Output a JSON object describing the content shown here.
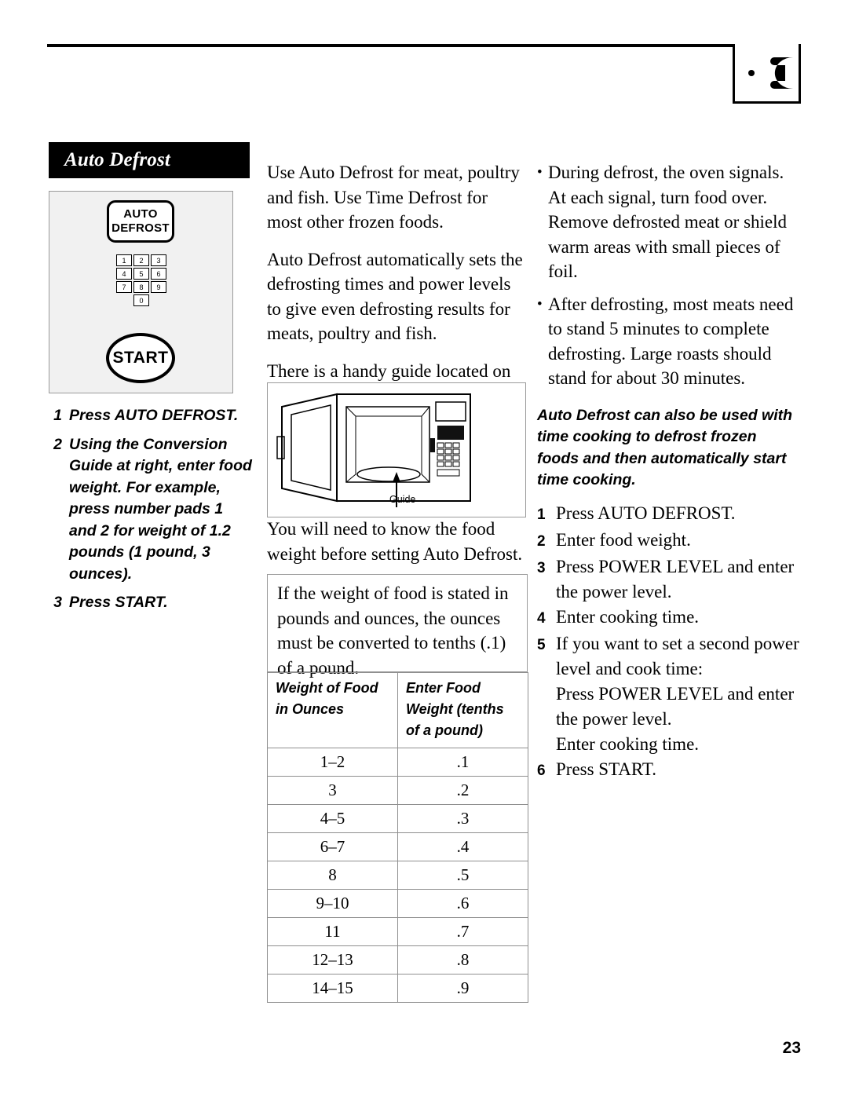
{
  "page": {
    "number": "23"
  },
  "section": {
    "title": "Auto Defrost"
  },
  "control_panel": {
    "auto_label": "AUTO",
    "defrost_label": "DEFROST",
    "keys": [
      "1",
      "2",
      "3",
      "4",
      "5",
      "6",
      "7",
      "8",
      "9",
      "0"
    ],
    "start_label": "START"
  },
  "left_steps": [
    {
      "num": "1",
      "text": "Press AUTO DEFROST."
    },
    {
      "num": "2",
      "text": "Using the Conversion Guide at right, enter food weight. For example, press number pads 1 and 2 for weight of 1.2 pounds (1 pound, 3 ounces)."
    },
    {
      "num": "3",
      "text": "Press START."
    }
  ],
  "middle": {
    "paragraphs": [
      "Use Auto Defrost for meat, poultry and fish. Use Time Defrost for most other frozen foods.",
      "Auto Defrost automatically sets the defrosting times and power levels to give even defrosting results for meats, poultry and fish.",
      "There is a handy guide located on the inside front of the oven."
    ],
    "figure_caption": "Guide",
    "after_figure": "You will need to know the food weight before setting Auto Defrost.",
    "conversion_intro": "If the weight of food is stated in pounds and ounces, the ounces must be converted to tenths (.1) of a pound."
  },
  "conversion_table": {
    "headers": [
      "Weight of Food in Ounces",
      "Enter Food Weight (tenths of a pound)"
    ],
    "header_lines": [
      [
        "Weight of Food",
        "in Ounces"
      ],
      [
        "Enter Food",
        "Weight (tenths",
        "of a pound)"
      ]
    ],
    "rows": [
      [
        "1–2",
        ".1"
      ],
      [
        "3",
        ".2"
      ],
      [
        "4–5",
        ".3"
      ],
      [
        "6–7",
        ".4"
      ],
      [
        "8",
        ".5"
      ],
      [
        "9–10",
        ".6"
      ],
      [
        "11",
        ".7"
      ],
      [
        "12–13",
        ".8"
      ],
      [
        "14–15",
        ".9"
      ]
    ]
  },
  "right": {
    "bullets": [
      "During defrost, the oven signals. At each signal, turn food over. Remove defrosted meat or shield warm areas with small pieces of foil.",
      "After defrosting, most meats need to stand 5 minutes to complete defrosting. Large roasts should stand for about 30 minutes."
    ],
    "callout": "Auto Defrost can also be used with time cooking to defrost frozen foods and then automatically start time cooking.",
    "steps": [
      {
        "num": "1",
        "text": "Press AUTO DEFROST."
      },
      {
        "num": "2",
        "text": "Enter food weight."
      },
      {
        "num": "3",
        "text": "Press POWER LEVEL and enter the power level."
      },
      {
        "num": "4",
        "text": "Enter cooking time."
      },
      {
        "num": "5",
        "text": "If you want to set a second power level and cook time:"
      },
      {
        "num": "",
        "text": "Press POWER LEVEL and enter the power level."
      },
      {
        "num": "",
        "text": "Enter cooking time."
      },
      {
        "num": "6",
        "text": "Press START."
      }
    ]
  }
}
